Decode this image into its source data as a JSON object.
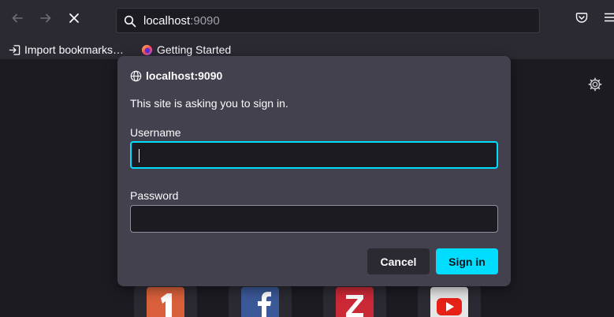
{
  "toolbar": {
    "url_host": "localhost",
    "url_port": ":9090",
    "back_icon": "arrow-left-icon",
    "forward_icon": "arrow-right-icon",
    "stop_icon": "close-icon",
    "pocket_icon": "pocket-icon",
    "menu_icon": "hamburger-menu-icon"
  },
  "bookmarks": {
    "items": [
      {
        "label": "Import bookmarks…",
        "icon": "import-icon"
      },
      {
        "label": "Getting Started",
        "icon": "firefox-icon"
      }
    ]
  },
  "dialog": {
    "origin": "localhost:9090",
    "message": "This site is asking you to sign in.",
    "username_label": "Username",
    "username_value": "",
    "password_label": "Password",
    "password_value": "",
    "cancel_label": "Cancel",
    "signin_label": "Sign in"
  },
  "tiles": [
    {
      "name": "tile-1",
      "text": "1",
      "color": "#d9603b"
    },
    {
      "name": "tile-facebook",
      "text": "f",
      "color": "#3b5998"
    },
    {
      "name": "tile-zotero",
      "text": "Z",
      "color": "#cc2936"
    },
    {
      "name": "tile-youtube",
      "text": "",
      "color": "#e0e0e0"
    }
  ],
  "colors": {
    "accent": "#00ddff",
    "dialog_bg": "#42414d",
    "toolbar_bg": "#2b2a33",
    "page_bg": "#1c1b22"
  }
}
